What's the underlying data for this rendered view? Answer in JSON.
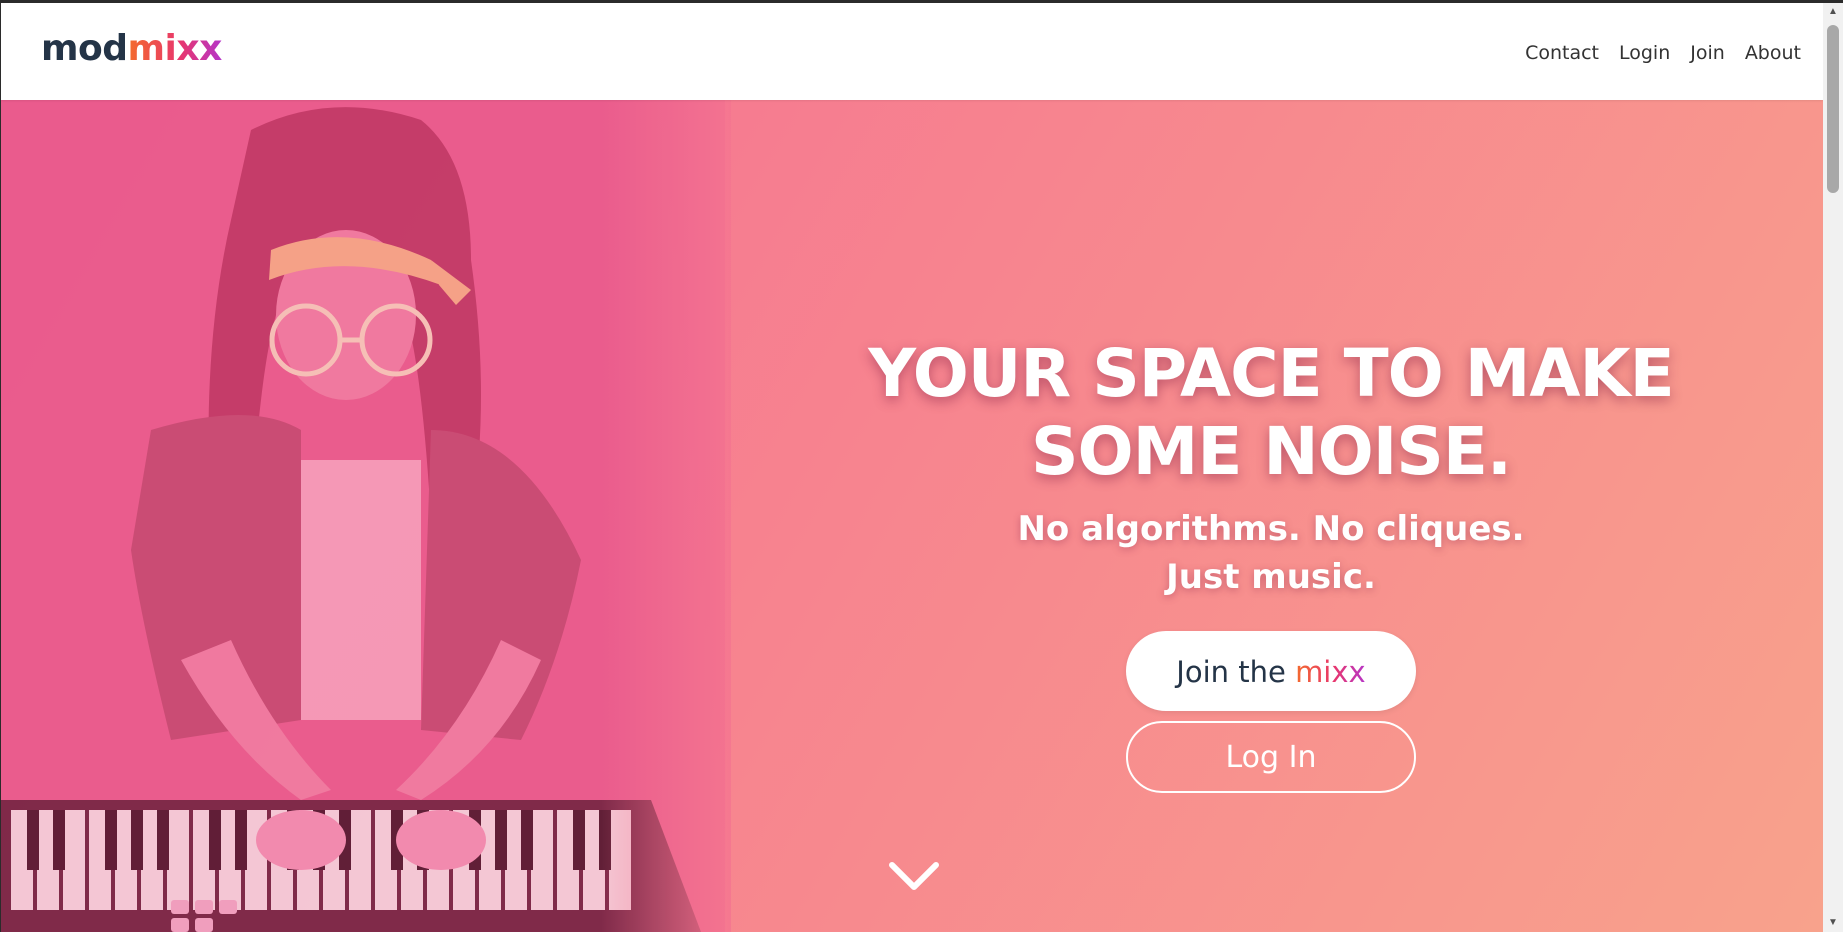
{
  "navbar": {
    "logo": {
      "part1": "mod",
      "part2": "mixx"
    },
    "links": [
      "Contact",
      "Login",
      "Join",
      "About"
    ]
  },
  "hero": {
    "headline_line1": "YOUR SPACE TO MAKE",
    "headline_line2": "SOME NOISE.",
    "subline_line1": "No algorithms. No cliques.",
    "subline_line2": "Just music.",
    "join_button": {
      "prefix": "Join the",
      "brand": "mixx"
    },
    "login_button": "Log In",
    "scroll_hint_icon": "chevron-down-icon",
    "photo_subject": "person-playing-keyboard-image"
  },
  "scrollbar": {
    "up_icon": "▲",
    "down_icon": "▼"
  },
  "colors": {
    "brand_dark": "#243447",
    "brand_gradient": [
      "#f46b2c",
      "#e8366d",
      "#b535c9"
    ],
    "hero_gradient": [
      "#f46a93",
      "#f7838f",
      "#f8a28c"
    ],
    "text_light": "#ffffff"
  }
}
